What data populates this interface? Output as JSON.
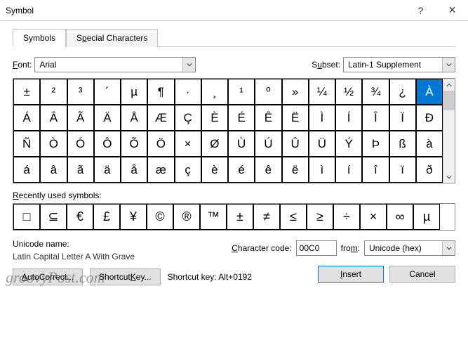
{
  "titlebar": {
    "title": "Symbol",
    "help": "?",
    "close": "×"
  },
  "tabs": {
    "symbols": "Symbols",
    "special": "Special Characters"
  },
  "font": {
    "label_pre": "F",
    "label_rest": "ont:",
    "value": "Arial",
    "subset_label_pre": "S",
    "subset_label_rest": "ubset:",
    "subset_value": "Latin-1 Supplement"
  },
  "grid": {
    "rows": [
      [
        "±",
        "²",
        "³",
        "´",
        "µ",
        "¶",
        "·",
        "¸",
        "¹",
        "º",
        "»",
        "¼",
        "½",
        "¾",
        "¿",
        "À"
      ],
      [
        "Á",
        "Â",
        "Ã",
        "Ä",
        "Å",
        "Æ",
        "Ç",
        "È",
        "É",
        "Ê",
        "Ë",
        "Ì",
        "Í",
        "Î",
        "Ï",
        "Ð"
      ],
      [
        "Ñ",
        "Ò",
        "Ó",
        "Ô",
        "Õ",
        "Ö",
        "×",
        "Ø",
        "Ù",
        "Ú",
        "Û",
        "Ü",
        "Ý",
        "Þ",
        "ß",
        "à"
      ],
      [
        "á",
        "â",
        "ã",
        "ä",
        "å",
        "æ",
        "ç",
        "è",
        "é",
        "ê",
        "ë",
        "ì",
        "í",
        "î",
        "ï",
        "ð"
      ]
    ],
    "selected": "À"
  },
  "recently": {
    "label_pre": "R",
    "label_rest": "ecently used symbols:",
    "items": [
      "□",
      "⊆",
      "€",
      "£",
      "¥",
      "©",
      "®",
      "™",
      "±",
      "≠",
      "≤",
      "≥",
      "÷",
      "×",
      "∞",
      "µ"
    ]
  },
  "unicode": {
    "name_label": "Unicode name:",
    "name_value": "Latin Capital Letter A With Grave",
    "code_label_pre": "C",
    "code_label_rest": "haracter code:",
    "code_value": "00C0",
    "from_label_pre": "fro",
    "from_label_m": "m",
    "from_label_post": ":",
    "from_value": "Unicode (hex)"
  },
  "buttons": {
    "autocorrect_pre": "A",
    "autocorrect_rest": "utoCorrect...",
    "shortcut_pre": "Shortcut ",
    "shortcut_k": "K",
    "shortcut_rest": "ey...",
    "shortcut_info": "Shortcut key: Alt+0192",
    "insert_pre": "I",
    "insert_rest": "nsert",
    "cancel": "Cancel"
  },
  "watermark": "groovyPost.com"
}
